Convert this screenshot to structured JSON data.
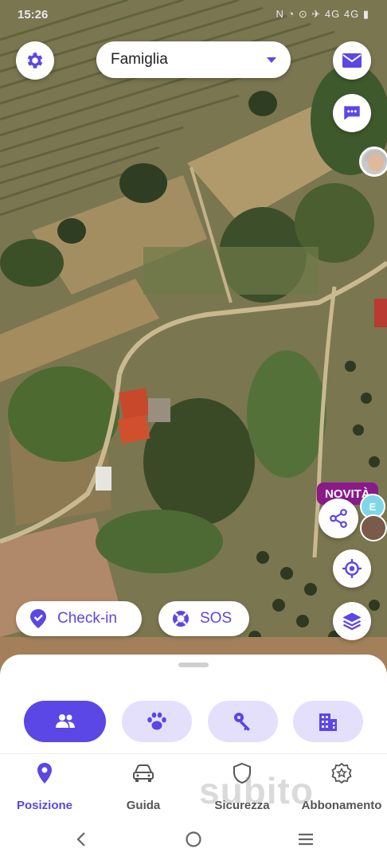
{
  "status_bar": {
    "time": "15:26",
    "indicators": "N ◔ ⊙ ✈ 4G 4G ▮"
  },
  "header": {
    "settings_icon": "gear-icon",
    "group_selector": {
      "selected": "Famiglia"
    },
    "mail_icon": "mail-icon",
    "chat_icon": "chat-icon"
  },
  "map_overlays": {
    "novita_badge": "NOVITÀ",
    "member_badge": "E",
    "share_icon": "share-icon",
    "locate_icon": "crosshair-icon",
    "layers_icon": "layers-icon"
  },
  "actions": {
    "checkin_label": "Check-in",
    "sos_label": "SOS"
  },
  "categories": [
    {
      "name": "people",
      "icon": "people-icon",
      "active": true
    },
    {
      "name": "pets",
      "icon": "paw-icon",
      "active": false
    },
    {
      "name": "keys",
      "icon": "key-icon",
      "active": false
    },
    {
      "name": "places",
      "icon": "building-icon",
      "active": false
    }
  ],
  "bottom_nav": {
    "posizione": "Posizione",
    "guida": "Guida",
    "sicurezza": "Sicurezza",
    "abbonamento": "Abbonamento"
  },
  "watermark": "subito",
  "colors": {
    "accent": "#5b46e6",
    "accent_light": "#e4e0fb",
    "novita_bg": "#8a1a8a"
  }
}
